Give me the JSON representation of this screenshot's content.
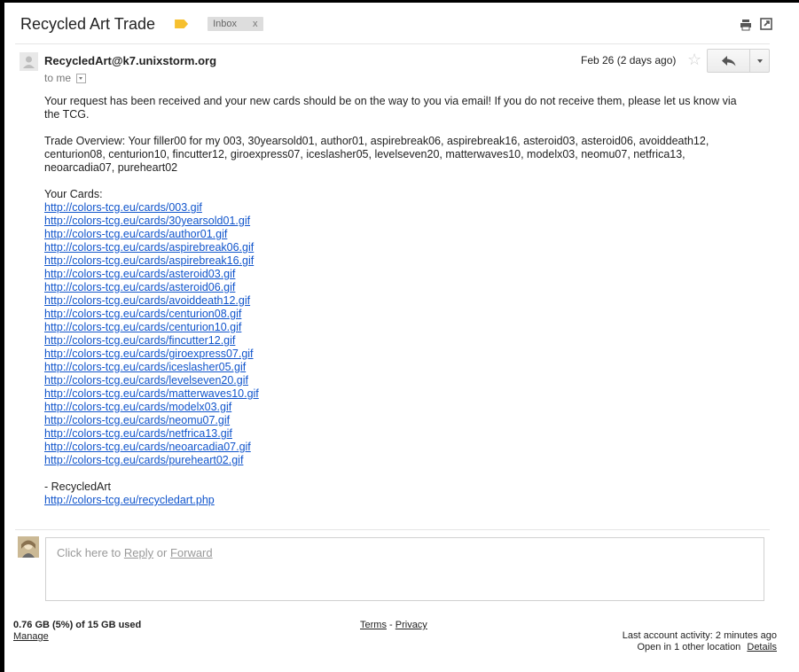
{
  "email": {
    "subject": "Recycled Art Trade",
    "label_chip": "Inbox",
    "label_chip_remove": "x",
    "sender": "RecycledArt@k7.unixstorm.org",
    "to_label": "to me",
    "date": "Feb 26 (2 days ago)",
    "body": {
      "intro": "Your request has been received and your new cards should be on the way to you via email!  If you do not receive them, please let us know via the TCG.",
      "trade_overview": "Trade Overview: Your filler00 for my 003, 30yearsold01, author01, aspirebreak06, aspirebreak16, asteroid03, asteroid06, avoiddeath12, centurion08, centurion10, fincutter12, giroexpress07, iceslasher05, levelseven20, matterwaves10, modelx03, neomu07, netfrica13, neoarcadia07, pureheart02",
      "cards_heading": "Your Cards:",
      "card_links": [
        "http://colors-tcg.eu/cards/003.gif",
        "http://colors-tcg.eu/cards/30yearsold01.gif",
        "http://colors-tcg.eu/cards/author01.gif",
        "http://colors-tcg.eu/cards/aspirebreak06.gif",
        "http://colors-tcg.eu/cards/aspirebreak16.gif",
        "http://colors-tcg.eu/cards/asteroid03.gif",
        "http://colors-tcg.eu/cards/asteroid06.gif",
        "http://colors-tcg.eu/cards/avoiddeath12.gif",
        "http://colors-tcg.eu/cards/centurion08.gif",
        "http://colors-tcg.eu/cards/centurion10.gif",
        "http://colors-tcg.eu/cards/fincutter12.gif",
        "http://colors-tcg.eu/cards/giroexpress07.gif",
        "http://colors-tcg.eu/cards/iceslasher05.gif",
        "http://colors-tcg.eu/cards/levelseven20.gif",
        "http://colors-tcg.eu/cards/matterwaves10.gif",
        "http://colors-tcg.eu/cards/modelx03.gif",
        "http://colors-tcg.eu/cards/neomu07.gif",
        "http://colors-tcg.eu/cards/netfrica13.gif",
        "http://colors-tcg.eu/cards/neoarcadia07.gif",
        "http://colors-tcg.eu/cards/pureheart02.gif"
      ],
      "signature": "- RecycledArt",
      "signature_link": "http://colors-tcg.eu/recycledart.php"
    }
  },
  "reply_box": {
    "prefix": "Click here to",
    "reply": "Reply",
    "or": "or",
    "forward": "Forward"
  },
  "footer": {
    "storage": "0.76 GB (5%) of 15 GB used",
    "manage": "Manage",
    "terms": "Terms",
    "separator": "-",
    "privacy": "Privacy",
    "last_activity": "Last account activity: 2 minutes ago",
    "open_in": "Open in 1 other location",
    "details": "Details"
  },
  "icons": {
    "label": "label-tag-icon",
    "print": "print-icon",
    "new_window": "new-window-icon",
    "star": "star-icon",
    "reply": "reply-arrow-icon",
    "more": "chevron-down-icon"
  },
  "colors": {
    "link": "#1155cc",
    "label_tag": "#f6c02f",
    "chip_bg": "#dddddd"
  }
}
